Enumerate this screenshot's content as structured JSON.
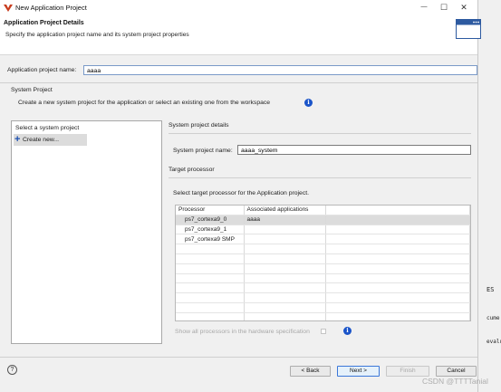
{
  "window": {
    "title": "New Application Project",
    "minimize": "—",
    "maximize": "☐",
    "close": "✕"
  },
  "header": {
    "heading": "Application Project Details",
    "subtitle": "Specify the application project name and its system project properties"
  },
  "app_name": {
    "label": "Application project name:",
    "value": "aaaa"
  },
  "system_project": {
    "legend": "System Project",
    "description": "Create a new system project for the application or select an existing one from the workspace",
    "list_title": "Select a system project",
    "create_new": "Create new...",
    "details_title": "System project details",
    "name_label": "System project name:",
    "name_value": "aaaa_system"
  },
  "target": {
    "title": "Target processor",
    "description": "Select target processor for the Application project.",
    "columns": [
      "Processor",
      "Associated applications"
    ],
    "rows": [
      {
        "processor": "ps7_cortexa9_0",
        "apps": "aaaa"
      },
      {
        "processor": "ps7_cortexa9_1",
        "apps": ""
      },
      {
        "processor": "ps7_cortexa9 SMP",
        "apps": ""
      }
    ],
    "show_all_label": "Show all processors in the hardware specification"
  },
  "footer": {
    "help": "?",
    "back": "< Back",
    "next": "Next >",
    "finish": "Finish",
    "cancel": "Cancel"
  },
  "background": {
    "text1": "ES",
    "text2": "cume",
    "text3": "evalu",
    "watermark": "CSDN @TTTTanial"
  },
  "colors": {
    "accent": "#1a54c9",
    "logo": "#c83c1e"
  }
}
